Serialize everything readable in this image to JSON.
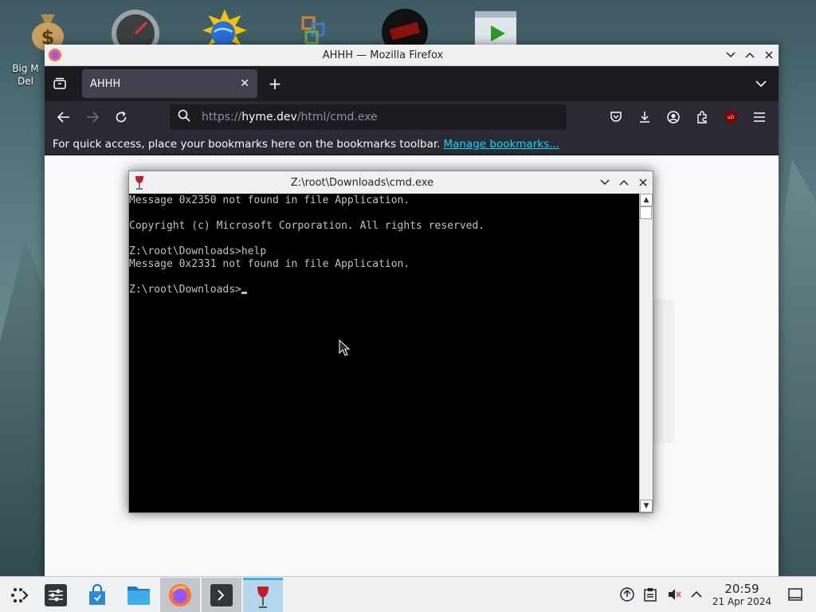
{
  "desktop": {
    "icon_label_1": "Big M",
    "icon_label_2": "Del"
  },
  "firefox": {
    "window_title": "AHHH — Mozilla Firefox",
    "tab_title": "AHHH",
    "url_prefix": "https://",
    "url_host": "hyme.dev",
    "url_path": "/html/cmd.exe",
    "bookmarks_text": "For quick access, place your bookmarks here on the bookmarks toolbar.",
    "bookmarks_link": "Manage bookmarks..."
  },
  "cmd": {
    "title": "Z:\\root\\Downloads\\cmd.exe",
    "lines": [
      "Message 0x2350 not found in file Application.",
      "",
      "Copyright (c) Microsoft Corporation. All rights reserved.",
      "",
      "Z:\\root\\Downloads>help",
      "Message 0x2331 not found in file Application.",
      "",
      "Z:\\root\\Downloads>"
    ]
  },
  "taskbar": {
    "time": "20:59",
    "date": "21 Apr 2024"
  },
  "colors": {
    "accent": "#3daee9",
    "link": "#00ddff",
    "terminal_text": "#c0c0c0",
    "firefox_dark": "#1c1b22"
  }
}
